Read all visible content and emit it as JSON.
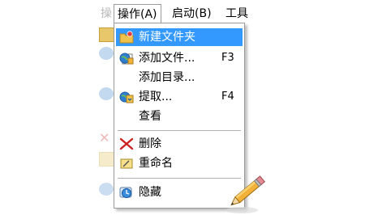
{
  "menubar": {
    "faded_left_text": "操",
    "items": [
      {
        "label": "操作(A)"
      },
      {
        "label": "启动(B)"
      },
      {
        "label": "工具"
      }
    ]
  },
  "dropdown": {
    "items": [
      {
        "label": "新建文件夹",
        "shortcut": "",
        "icon": "new-folder-icon",
        "highlighted": true
      },
      {
        "label": "添加文件...",
        "shortcut": "F3",
        "icon": "add-files-icon"
      },
      {
        "label": "添加目录...",
        "shortcut": "",
        "icon": ""
      },
      {
        "label": "提取...",
        "shortcut": "F4",
        "icon": "extract-icon"
      },
      {
        "label": "查看",
        "shortcut": "",
        "icon": ""
      },
      {
        "label": "删除",
        "shortcut": "",
        "icon": "delete-icon"
      },
      {
        "label": "重命名",
        "shortcut": "",
        "icon": "rename-icon"
      },
      {
        "label": "隐藏",
        "shortcut": "",
        "icon": "hide-icon"
      }
    ]
  },
  "colors": {
    "highlight": "#3399ff",
    "delete_x": "#cc2222",
    "folder": "#f0c24b",
    "globe": "#2f7fd0"
  }
}
